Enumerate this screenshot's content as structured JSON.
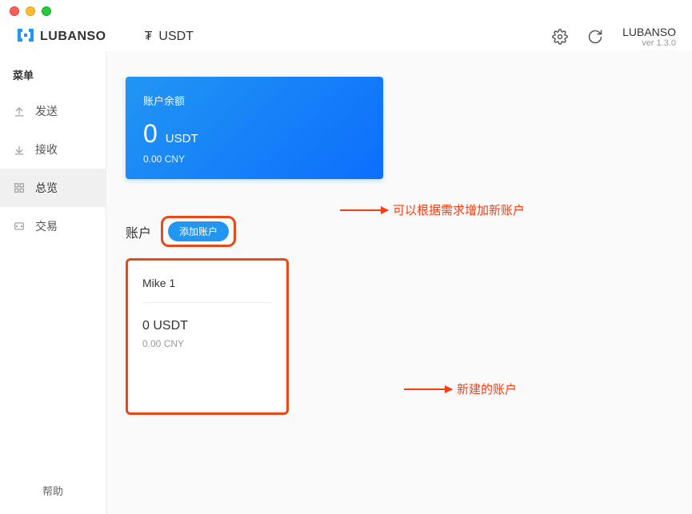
{
  "app": {
    "name": "LUBANSO",
    "version": "ver 1.3.0"
  },
  "currency": {
    "symbol": "₮",
    "code": "USDT"
  },
  "sidebar": {
    "title": "菜单",
    "items": [
      {
        "label": "发送",
        "active": false
      },
      {
        "label": "接收",
        "active": false
      },
      {
        "label": "总览",
        "active": true
      },
      {
        "label": "交易",
        "active": false
      }
    ],
    "help": "帮助"
  },
  "balance": {
    "label": "账户余额",
    "amount": "0",
    "unit": "USDT",
    "cny": "0.00 CNY"
  },
  "accounts": {
    "header": "账户",
    "add_label": "添加账户",
    "list": [
      {
        "name": "Mike 1",
        "amount": "0 USDT",
        "cny": "0.00 CNY"
      }
    ]
  },
  "annotations": {
    "a1": "可以根据需求增加新账户",
    "a2": "新建的账户"
  }
}
